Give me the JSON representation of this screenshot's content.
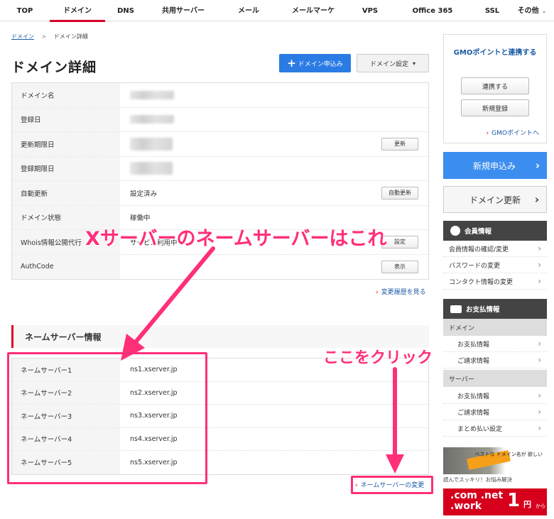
{
  "nav": {
    "tabs": [
      {
        "label": "TOP"
      },
      {
        "label": "ドメイン"
      },
      {
        "label": "DNS"
      },
      {
        "label": "共用サーバー"
      },
      {
        "label": "メール"
      },
      {
        "label": "メールマーケ"
      },
      {
        "label": "VPS"
      },
      {
        "label": "Office 365"
      },
      {
        "label": "SSL"
      },
      {
        "label": "その他"
      }
    ],
    "active_tab": "ドメイン",
    "accent_color": "#d9002b"
  },
  "breadcrumb": {
    "home": "ドメイン",
    "separator": ">",
    "current": "ドメイン詳細"
  },
  "page": {
    "title": "ドメイン詳細",
    "apply_button": "ドメイン申込み",
    "settings_button": "ドメイン設定"
  },
  "detail": {
    "rows": [
      {
        "label": "ドメイン名",
        "value": "",
        "button": ""
      },
      {
        "label": "登録日",
        "value": "",
        "button": ""
      },
      {
        "label": "更新期限日",
        "value": "",
        "button": "更新"
      },
      {
        "label": "登録期限日",
        "value": "",
        "button": ""
      },
      {
        "label": "自動更新",
        "value": "設定済み",
        "button": "自動更新"
      },
      {
        "label": "ドメイン状態",
        "value": "稼働中",
        "button": ""
      },
      {
        "label": "Whois情報公開代行",
        "value": "サービス利用中",
        "button": "設定"
      },
      {
        "label": "AuthCode",
        "value": "",
        "button": "表示"
      }
    ],
    "history_link": "変更履歴を見る"
  },
  "nameserver": {
    "heading": "ネームサーバー情報",
    "rows": [
      {
        "label": "ネームサーバー1",
        "value": "ns1.xserver.jp"
      },
      {
        "label": "ネームサーバー2",
        "value": "ns2.xserver.jp"
      },
      {
        "label": "ネームサーバー3",
        "value": "ns3.xserver.jp"
      },
      {
        "label": "ネームサーバー4",
        "value": "ns4.xserver.jp"
      },
      {
        "label": "ネームサーバー5",
        "value": "ns5.xserver.jp"
      }
    ],
    "change_link": "ネームサーバーの変更"
  },
  "annotations": {
    "main": "Xサーバーのネームサーバーはこれ",
    "click": "ここをクリック",
    "color": "#ff2f7a"
  },
  "sidebar": {
    "gmo": {
      "title": "GMOポイントと連携する",
      "link_button": "連携する",
      "register_button": "新規登録",
      "points_link": "GMOポイントへ"
    },
    "new_apply": "新規申込み",
    "domain_renew": "ドメイン更新",
    "member": {
      "heading": "会員情報",
      "items": [
        "会員情報の確認/変更",
        "パスワードの変更",
        "コンタクト情報の変更"
      ]
    },
    "payment": {
      "heading": "お支払情報",
      "domain_label": "ドメイン",
      "domain_items": [
        "お支払情報",
        "ご請求情報"
      ],
      "server_label": "サーバー",
      "server_items": [
        "お支払情報",
        "ご請求情報",
        "まとめ払い設定"
      ]
    },
    "banner1": {
      "text": "ベストな ドメイン名が 欲しい",
      "caption": "読んでスッキリ！お悩み解決"
    },
    "banner2": {
      "domains": ".com .net",
      "work": ".work",
      "price": "1",
      "unit": "円",
      "suffix": "から"
    }
  }
}
